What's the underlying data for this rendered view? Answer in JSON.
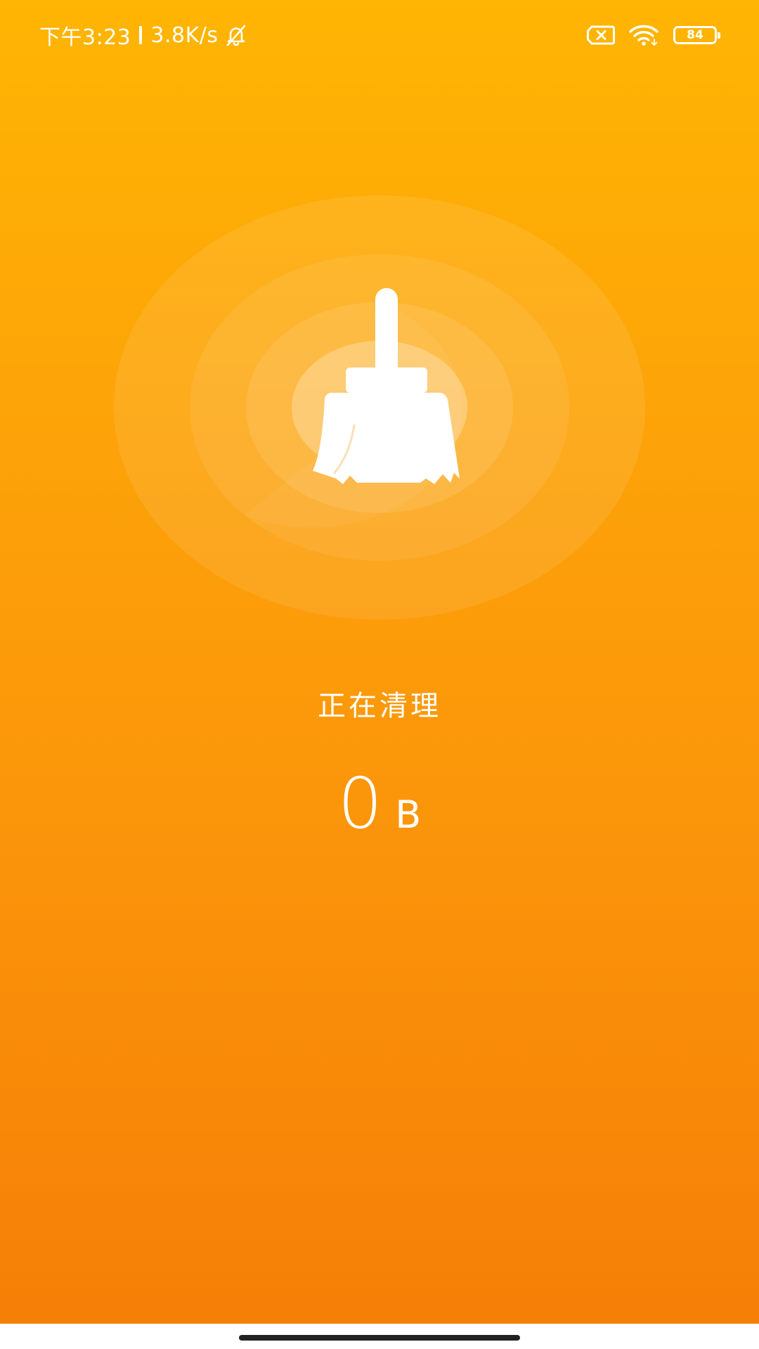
{
  "status_bar": {
    "time": "下午3:23",
    "net_speed": "3.8K/s",
    "mute_icon": "bell-off-icon",
    "sim_icon": "sim-no-signal-icon",
    "wifi_icon": "wifi-icon",
    "battery_level": "84"
  },
  "cleaner": {
    "icon": "broom-icon",
    "status_label": "正在清理",
    "cleaned_value": "0",
    "cleaned_unit": "B"
  },
  "colors": {
    "gradient_top": "#ffb503",
    "gradient_bottom": "#f67f07",
    "foreground": "#ffffff"
  }
}
